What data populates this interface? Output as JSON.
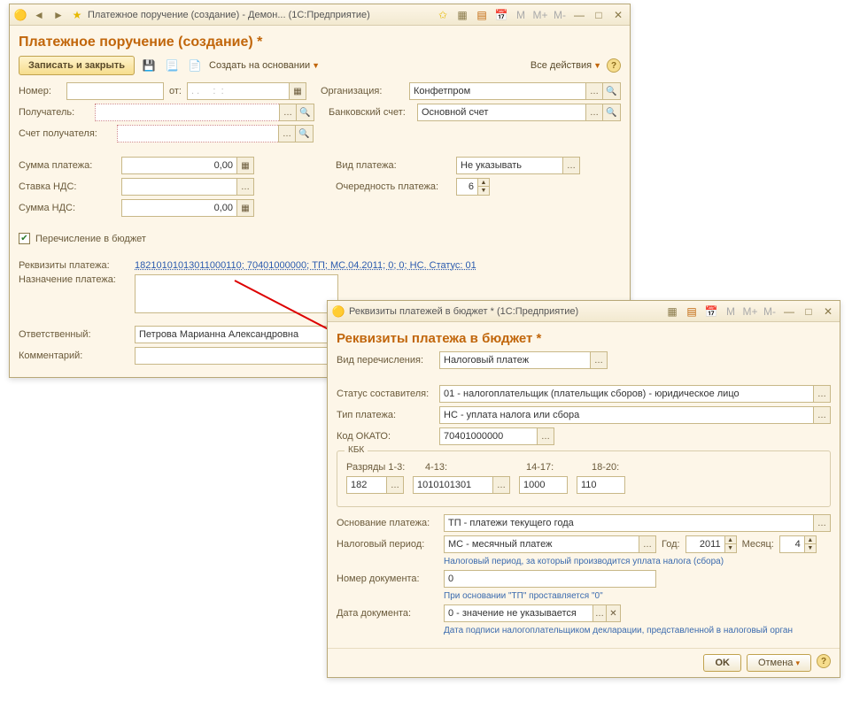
{
  "win1": {
    "title": "Платежное поручение (создание) - Демон...   (1С:Предприятие)",
    "pageTitle": "Платежное поручение (создание) *",
    "toolbar": {
      "saveClose": "Записать и закрыть",
      "createBased": "Создать на основании",
      "allActions": "Все действия"
    },
    "labels": {
      "number": "Номер:",
      "from": "от:",
      "org": "Организация:",
      "recipient": "Получатель:",
      "bankAccount": "Банковский счет:",
      "recipAccount": "Счет получателя:",
      "paySum": "Сумма платежа:",
      "payKind": "Вид платежа:",
      "vatRate": "Ставка НДС:",
      "payPriority": "Очередность платежа:",
      "vatSum": "Сумма НДС:",
      "budgetTransfer": "Перечисление в бюджет",
      "payDetails": "Реквизиты платежа:",
      "payPurpose": "Назначение платежа:",
      "responsible": "Ответственный:",
      "comment": "Комментарий:"
    },
    "values": {
      "date": ". .     :  :",
      "org": "Конфетпром",
      "bankAccount": "Основной счет",
      "paySum": "0,00",
      "payKind": "Не указывать",
      "payPriority": "6",
      "vatSum": "0,00",
      "payDetailsLink": "18210101013011000110; 70401000000; ТП; МС.04.2011; 0; 0; НС. Статус: 01",
      "responsible": "Петрова Марианна Александровна"
    }
  },
  "win2": {
    "title": "Реквизиты платежей в бюджет *   (1С:Предприятие)",
    "pageTitle": "Реквизиты платежа в бюджет *",
    "labels": {
      "transferKind": "Вид перечисления:",
      "compilerStatus": "Статус составителя:",
      "payType": "Тип платежа:",
      "okato": "Код ОКАТО:",
      "kbk": "КБК",
      "kbk13": "Разряды 1-3:",
      "kbk413": "4-13:",
      "kbk1417": "14-17:",
      "kbk1820": "18-20:",
      "payBasis": "Основание платежа:",
      "taxPeriod": "Налоговый период:",
      "year": "Год:",
      "month": "Месяц:",
      "docNumber": "Номер документа:",
      "docDate": "Дата документа:"
    },
    "values": {
      "transferKind": "Налоговый платеж",
      "compilerStatus": "01 - налогоплательщик (плательщик сборов) - юридическое лицо",
      "payType": "НС - уплата налога или сбора",
      "okato": "70401000000",
      "kbk13": "182",
      "kbk413": "1010101301",
      "kbk1417": "1000",
      "kbk1820": "110",
      "payBasis": "ТП - платежи текущего года",
      "taxPeriod": "МС - месячный платеж",
      "year": "2011",
      "month": "4",
      "docNumber": "0",
      "docDate": "0 - значение не указывается"
    },
    "hints": {
      "taxPeriod": "Налоговый период, за который производится уплата налога (сбора)",
      "docNumber": "При основании \"ТП\" проставляется \"0\"",
      "docDate": "Дата подписи налогоплательщиком декларации, представленной в налоговый орган"
    },
    "buttons": {
      "ok": "OK",
      "cancel": "Отмена"
    }
  }
}
